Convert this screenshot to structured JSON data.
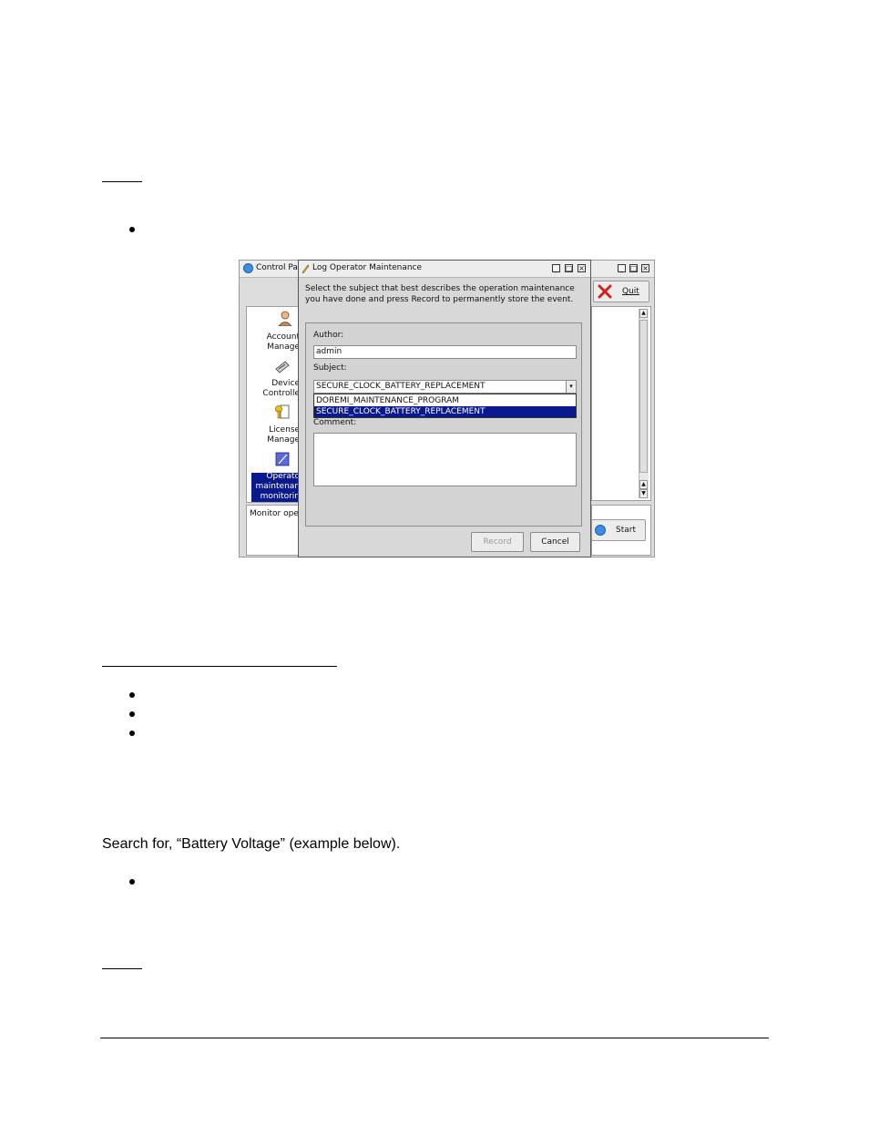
{
  "document": {
    "paragraph": "Search for, “Battery Voltage” (example below)."
  },
  "screenshot": {
    "background_window": {
      "title": "Control Pa",
      "quit_label": "Quit",
      "start_label": "Start",
      "monitor_text": "Monitor ope",
      "sidebar": [
        {
          "label": "Account\nManage"
        },
        {
          "label": "Device\nControlle"
        },
        {
          "label": "License\nManage"
        },
        {
          "label": "Operato\nmaintenan\nmonitorin"
        }
      ]
    },
    "dialog": {
      "title": "Log Operator Maintenance",
      "description_line1": "Select the subject that best describes the operation maintenance",
      "description_line2": "you have done and press Record to permanently store the event.",
      "author_label": "Author:",
      "author_value": "admin",
      "subject_label": "Subject:",
      "subject_value": "SECURE_CLOCK_BATTERY_REPLACEMENT",
      "subject_options": [
        "DOREMI_MAINTENANCE_PROGRAM",
        "SECURE_CLOCK_BATTERY_REPLACEMENT"
      ],
      "comment_label": "Comment:",
      "record_label": "Record",
      "cancel_label": "Cancel"
    },
    "colors": {
      "selection": "#0a1a8c",
      "quit_icon": "#d62020",
      "app_icon": "#3d8ee0"
    }
  }
}
